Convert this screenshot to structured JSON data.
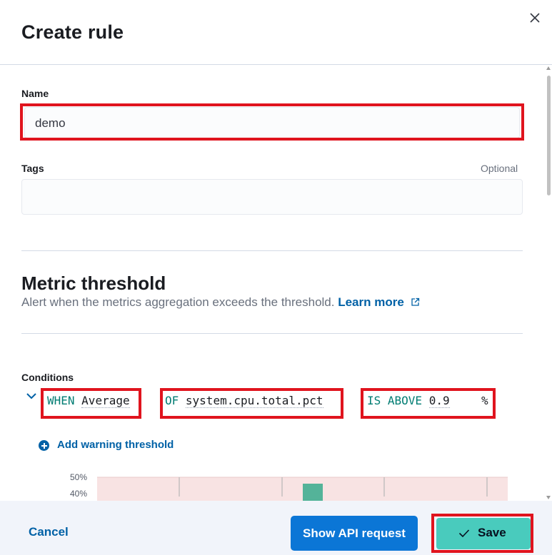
{
  "flyout": {
    "title": "Create rule",
    "close_icon": "close-icon"
  },
  "form": {
    "name": {
      "label": "Name",
      "value": "demo"
    },
    "tags": {
      "label": "Tags",
      "optional": "Optional",
      "value": ""
    }
  },
  "metric": {
    "title": "Metric threshold",
    "description": "Alert when the metrics aggregation exceeds the threshold.",
    "learn_more": "Learn more",
    "external_icon": "external-link-icon"
  },
  "conditions": {
    "label": "Conditions",
    "expand_icon": "chevron-down-icon",
    "when": {
      "keyword": "WHEN",
      "value": "Average"
    },
    "of": {
      "keyword": "OF",
      "value": "system.cpu.total.pct"
    },
    "threshold": {
      "keyword": "IS ABOVE",
      "value": "0.9",
      "unit": "%"
    },
    "add_warning": "Add warning threshold",
    "add_icon": "plus-circle-icon"
  },
  "chart_data": {
    "type": "bar",
    "y_ticks": [
      "50%",
      "40%"
    ],
    "bars_visible": 1,
    "threshold_band_color": "#f8e3e3",
    "bar_color": "#54b399"
  },
  "footer": {
    "cancel": "Cancel",
    "api_request": "Show API request",
    "save": "Save",
    "check_icon": "check-icon"
  },
  "colors": {
    "accent_blue": "#0b76d6",
    "save_green": "#49cbbd",
    "highlight_red": "#e0141e",
    "keyword_teal": "#017d73"
  }
}
